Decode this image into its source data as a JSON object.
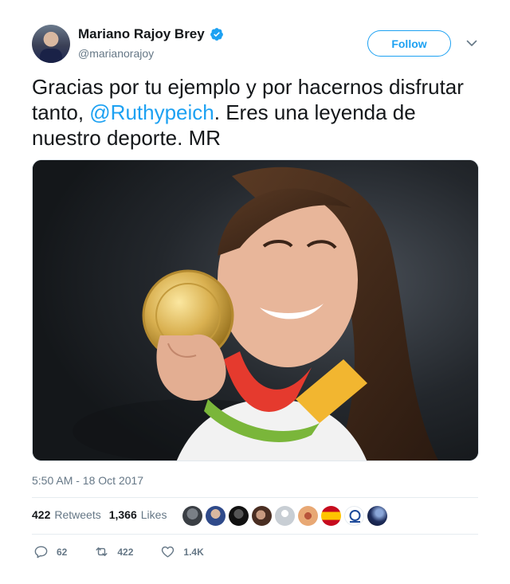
{
  "author": {
    "display_name": "Mariano Rajoy Brey",
    "handle": "@marianorajoy",
    "verified": true
  },
  "follow_button": {
    "label": "Follow"
  },
  "tweet": {
    "text_before": "Gracias por tu ejemplo y por hacernos disfrutar tanto, ",
    "mention": "@Ruthypeich",
    "text_after": ". Eres una leyenda de nuestro deporte. MR",
    "timestamp": "5:50 AM - 18 Oct 2017"
  },
  "stats": {
    "retweets_count": "422",
    "retweets_label": "Retweets",
    "likes_count": "1,366",
    "likes_label": "Likes"
  },
  "likers": [
    {
      "name": "liker-1",
      "color": "#4a4f55"
    },
    {
      "name": "liker-2",
      "color": "#2f4a8a"
    },
    {
      "name": "liker-3",
      "color": "#1c1c1c"
    },
    {
      "name": "liker-4",
      "color": "#6b4a3a"
    },
    {
      "name": "liker-5",
      "color": "#c8ced4"
    },
    {
      "name": "liker-6",
      "color": "#e0a070"
    },
    {
      "name": "liker-7",
      "color": "#d42a1e"
    },
    {
      "name": "liker-8",
      "color": "#ffffff"
    },
    {
      "name": "liker-9",
      "color": "#2a3f7a"
    }
  ],
  "actions": {
    "replies": "62",
    "retweets": "422",
    "likes": "1.4K"
  },
  "colors": {
    "accent": "#1da1f2",
    "secondary_text": "#657786",
    "primary_text": "#14171a"
  }
}
